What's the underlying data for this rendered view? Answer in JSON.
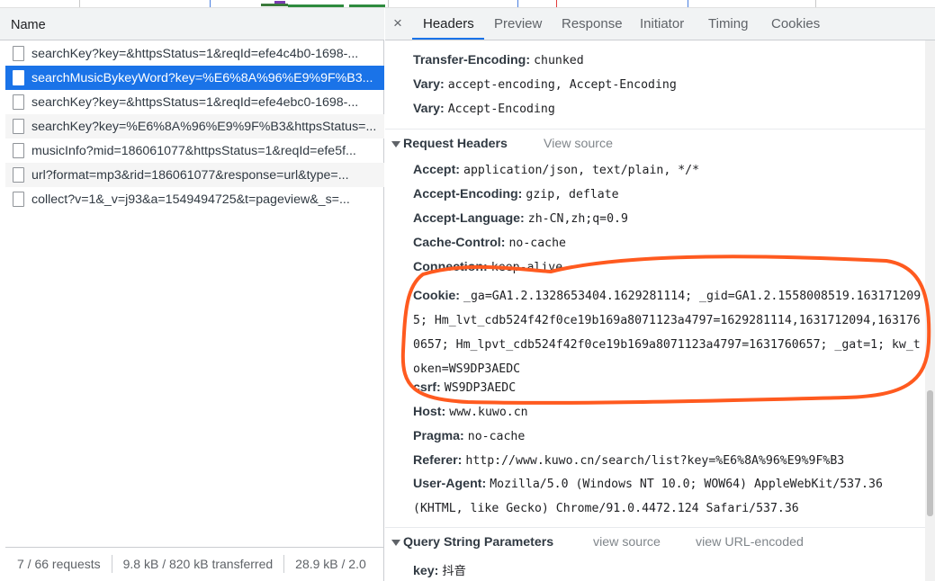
{
  "left_panel": {
    "column_header": "Name",
    "requests": [
      "searchKey?key=&httpsStatus=1&reqId=efe4c4b0-1698-...",
      "searchMusicBykeyWord?key=%E6%8A%96%E9%9F%B3...",
      "searchKey?key=&httpsStatus=1&reqId=efe4ebc0-1698-...",
      "searchKey?key=%E6%8A%96%E9%9F%B3&httpsStatus=...",
      "musicInfo?mid=186061077&httpsStatus=1&reqId=efe5f...",
      "url?format=mp3&rid=186061077&response=url&type=...",
      "collect?v=1&_v=j93&a=1549494725&t=pageview&_s=..."
    ],
    "selected_index": 1,
    "status": {
      "requests": "7 / 66 requests",
      "transferred": "9.8 kB / 820 kB transferred",
      "resources": "28.9 kB / 2.0"
    }
  },
  "right_panel": {
    "close": "×",
    "tabs": [
      "Headers",
      "Preview",
      "Response",
      "Initiator",
      "Timing",
      "Cookies"
    ],
    "active_tab": "Headers",
    "response_headers_tail": [
      {
        "name": "Transfer-Encoding:",
        "value": "chunked"
      },
      {
        "name": "Vary:",
        "value": "accept-encoding, Accept-Encoding"
      },
      {
        "name": "Vary:",
        "value": "Accept-Encoding"
      }
    ],
    "request_headers": {
      "title": "Request Headers",
      "view_source": "View source",
      "rows": [
        {
          "name": "Accept:",
          "value": "application/json, text/plain, */*"
        },
        {
          "name": "Accept-Encoding:",
          "value": "gzip, deflate"
        },
        {
          "name": "Accept-Language:",
          "value": "zh-CN,zh;q=0.9"
        },
        {
          "name": "Cache-Control:",
          "value": "no-cache"
        },
        {
          "name": "Connection:",
          "value": "keep-alive"
        }
      ],
      "cookie": {
        "name": "Cookie:",
        "value": "_ga=GA1.2.1328653404.1629281114; _gid=GA1.2.1558008519.1631712095; Hm_lvt_cdb524f42f0ce19b169a8071123a4797=1629281114,1631712094,1631760657; Hm_lpvt_cdb524f42f0ce19b169a8071123a4797=1631760657; _gat=1; kw_token=WS9DP3AEDC"
      },
      "rows_after": [
        {
          "name": "csrf:",
          "value": "WS9DP3AEDC"
        },
        {
          "name": "Host:",
          "value": "www.kuwo.cn"
        },
        {
          "name": "Pragma:",
          "value": "no-cache"
        },
        {
          "name": "Referer:",
          "value": "http://www.kuwo.cn/search/list?key=%E6%8A%96%E9%9F%B3"
        }
      ],
      "user_agent": {
        "name": "User-Agent:",
        "value": "Mozilla/5.0 (Windows NT 10.0; WOW64) AppleWebKit/537.36 (KHTML, like Gecko) Chrome/91.0.4472.124 Safari/537.36"
      }
    },
    "query_params": {
      "title": "Query String Parameters",
      "view_source": "view source",
      "view_url_encoded": "view URL-encoded",
      "rows": [
        {
          "name": "key:",
          "value": "抖音"
        }
      ]
    }
  },
  "colors": {
    "selected_row": "#1a73e8",
    "annotation_stroke": "#ff5a1f"
  }
}
